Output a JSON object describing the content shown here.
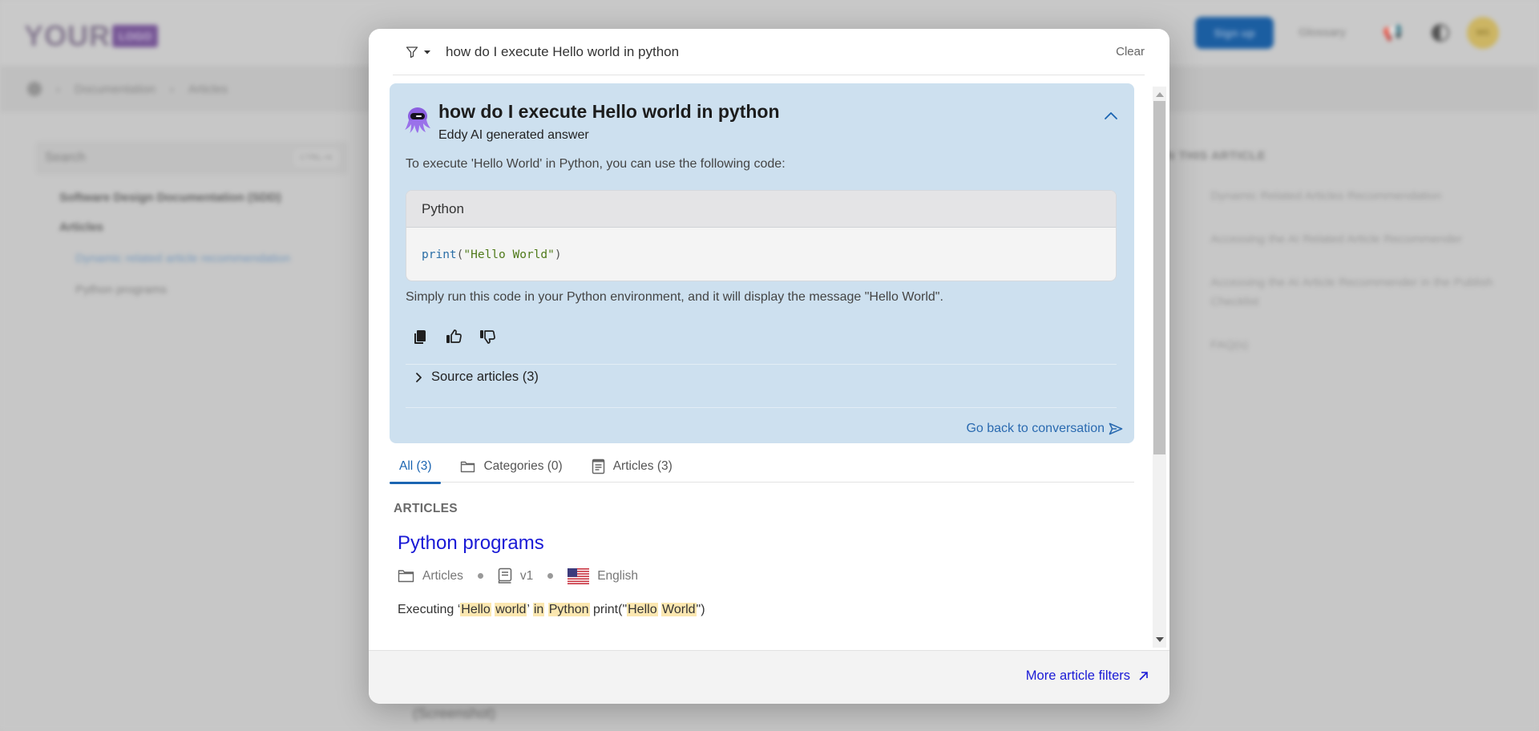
{
  "background": {
    "logo": {
      "text": "YOUR",
      "badge": "LOGO"
    },
    "nav": {
      "signup": "Sign up",
      "glossary": "Glossary",
      "avatar_initials": "MS"
    },
    "breadcrumb": [
      "Documentation",
      "Articles"
    ],
    "sidebar": {
      "search_placeholder": "Search",
      "search_shortcut": "CTRL+K",
      "items": [
        {
          "label": "Software Design Documentation (SDD)"
        },
        {
          "label": "Articles"
        }
      ],
      "sub_items": [
        {
          "label": "Dynamic related article recommendation",
          "active": true
        },
        {
          "label": "Python programs",
          "active": false
        }
      ]
    },
    "toc": {
      "title": "IN THIS ARTICLE",
      "items": [
        "Dynamic Related Articles Recommendation",
        "Accessing the AI Related Article Recommender",
        "Accessing the AI Article Recommender in the Publish Checklist",
        "FAQ(s)"
      ]
    },
    "bottom_text": "(Screenshot)"
  },
  "modal": {
    "search": {
      "value": "how do I execute Hello world in python",
      "clear_label": "Clear"
    },
    "ai_answer": {
      "question": "how do I execute Hello world in python",
      "subtitle": "Eddy AI generated answer",
      "intro": "To execute 'Hello World' in Python, you can use the following code:",
      "code_language": "Python",
      "code": {
        "fn": "print",
        "open": "(",
        "string": "\"Hello World\"",
        "close": ")"
      },
      "outro": "Simply run this code in your Python environment, and it will display the message \"Hello World\".",
      "sources_label": "Source articles (3)",
      "back_label": "Go back to conversation"
    },
    "tabs": [
      {
        "label": "All (3)",
        "icon": "none",
        "active": true
      },
      {
        "label": "Categories (0)",
        "icon": "folder-icon",
        "active": false
      },
      {
        "label": "Articles (3)",
        "icon": "article-icon",
        "active": false
      }
    ],
    "results": {
      "section_label": "ARTICLES",
      "items": [
        {
          "title": "Python programs",
          "category": "Articles",
          "version": "v1",
          "language": "English",
          "snippet_parts": [
            {
              "text": "Executing ‘",
              "hl": false
            },
            {
              "text": "Hello",
              "hl": true
            },
            {
              "text": " ",
              "hl": false
            },
            {
              "text": "world",
              "hl": true
            },
            {
              "text": "’ ",
              "hl": false
            },
            {
              "text": "in",
              "hl": true
            },
            {
              "text": " ",
              "hl": false
            },
            {
              "text": "Python",
              "hl": true
            },
            {
              "text": " print(\"",
              "hl": false
            },
            {
              "text": "Hello",
              "hl": true
            },
            {
              "text": " ",
              "hl": false
            },
            {
              "text": "World",
              "hl": true
            },
            {
              "text": "\")",
              "hl": false
            }
          ]
        }
      ]
    },
    "footer": {
      "more_filters_label": "More article filters"
    }
  },
  "colors": {
    "accent": "#1b65b2",
    "link": "#1a1ad6",
    "ai_card_bg": "#cde0ef",
    "highlight": "#fbe7b0"
  }
}
